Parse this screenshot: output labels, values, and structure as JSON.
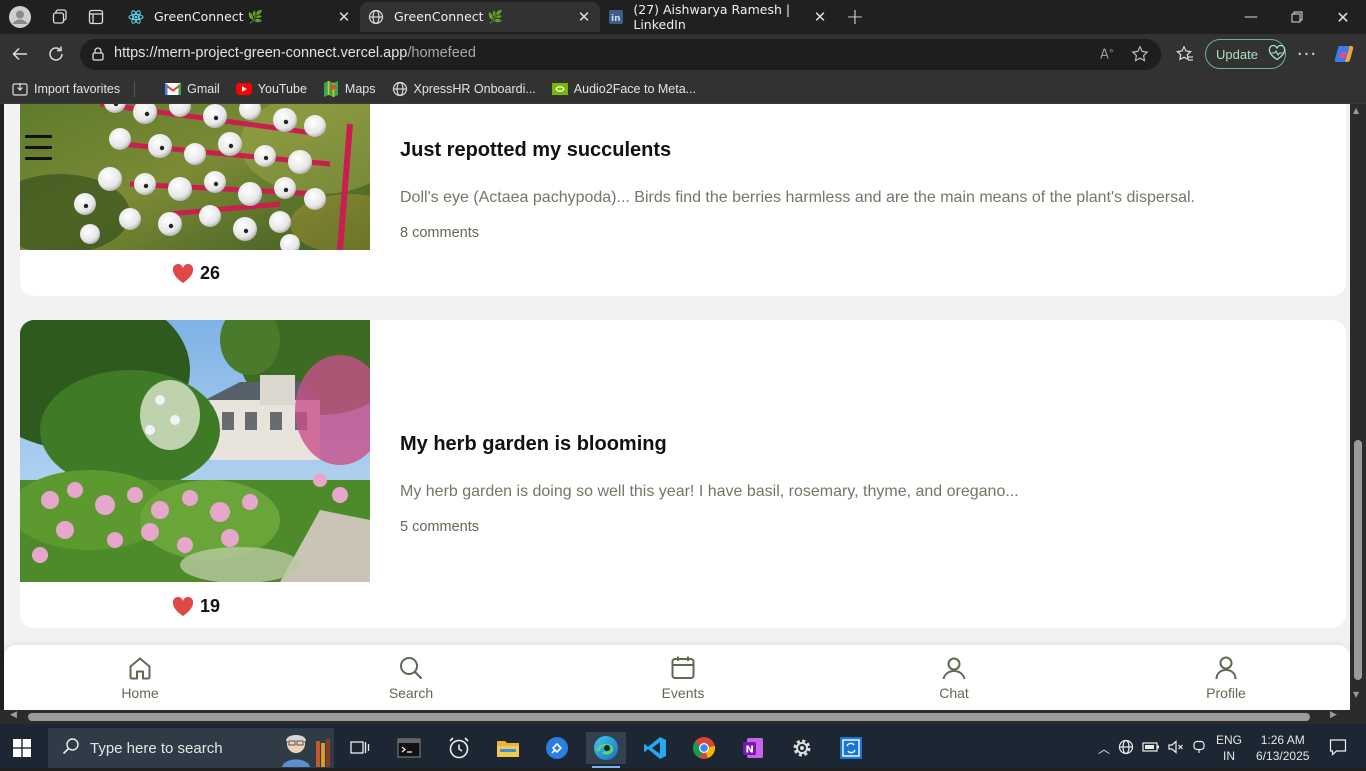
{
  "browser": {
    "tabs": [
      {
        "title": "GreenConnect 🌿",
        "active": false
      },
      {
        "title": "GreenConnect 🌿",
        "active": true
      },
      {
        "title": "(27) Aishwarya Ramesh | LinkedIn",
        "active": false
      }
    ],
    "url_host": "https://mern-project-green-connect.vercel.app",
    "url_path": "/homefeed",
    "update_label": "Update",
    "favorites": [
      "Import favorites",
      "Gmail",
      "YouTube",
      "Maps",
      "XpressHR Onboardi...",
      "Audio2Face to Meta..."
    ]
  },
  "feed": {
    "posts": [
      {
        "title": "Just repotted my succulents",
        "description": "Doll's eye (Actaea pachypoda)... Birds find the berries harmless and are the main means of the plant's dispersal.",
        "comments": "8 comments",
        "likes": "26"
      },
      {
        "title": "My herb garden is blooming",
        "description": "My herb garden is doing so well this year! I have basil, rosemary, thyme, and oregano...",
        "comments": "5 comments",
        "likes": "19"
      }
    ]
  },
  "bottom_nav": {
    "items": [
      "Home",
      "Search",
      "Events",
      "Chat",
      "Profile"
    ]
  },
  "taskbar": {
    "search_placeholder": "Type here to search",
    "lang_top": "ENG",
    "lang_bottom": "IN",
    "time": "1:26 AM",
    "date": "6/13/2025"
  },
  "colors": {
    "accent_green": "#5d6b52",
    "heart": "#e04848"
  }
}
